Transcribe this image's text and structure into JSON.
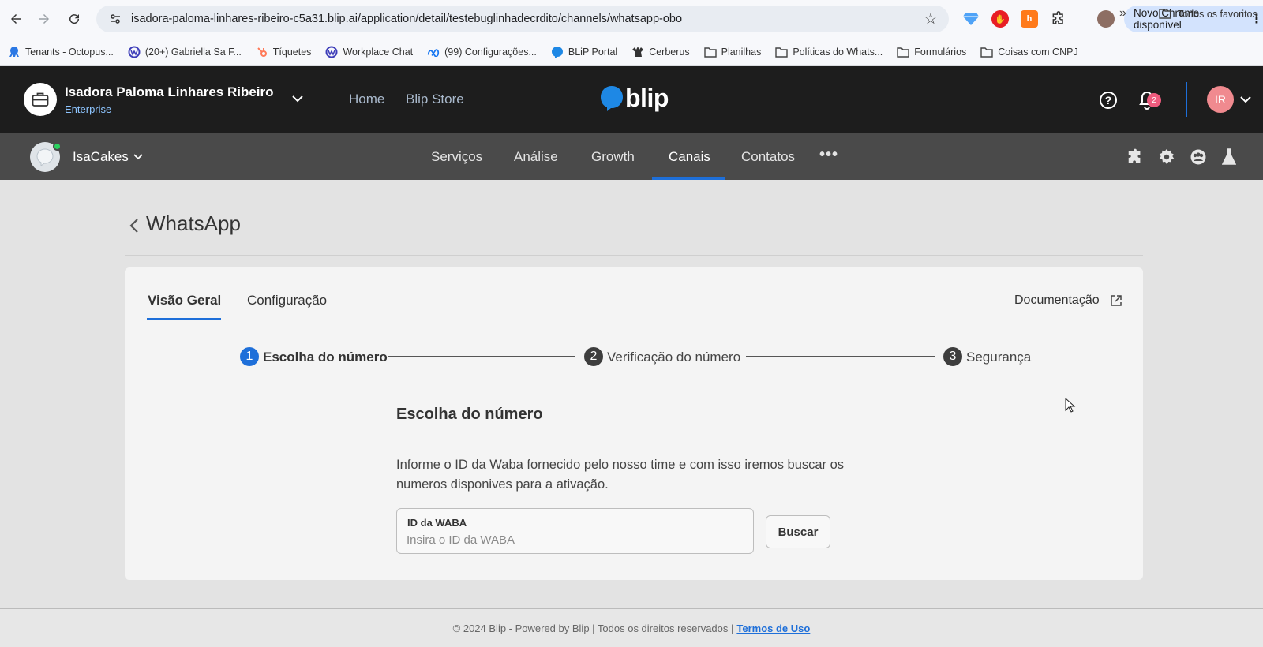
{
  "browser": {
    "url": "isadora-paloma-linhares-ribeiro-c5a31.blip.ai/application/detail/testebuglinhadecrdito/channels/whatsapp-obo",
    "update_label": "Novo Chrome disponível"
  },
  "bookmarks": [
    {
      "label": "Tenants - Octopus...",
      "icon": "octopus-icon",
      "color": "#2b78e4"
    },
    {
      "label": "(20+) Gabriella Sa F...",
      "icon": "workplace-icon",
      "color": "#3b3bb8"
    },
    {
      "label": "Tíquetes",
      "icon": "hubspot-icon",
      "color": "#ff7a59"
    },
    {
      "label": "Workplace Chat",
      "icon": "workplace-icon",
      "color": "#3b3bb8"
    },
    {
      "label": "(99) Configurações...",
      "icon": "meta-icon",
      "color": "#1877f2"
    },
    {
      "label": "BLiP Portal",
      "icon": "blip-icon",
      "color": "#1e88e5"
    },
    {
      "label": "Cerberus",
      "icon": "cerberus-icon",
      "color": "#333333"
    },
    {
      "label": "Planilhas",
      "icon": "folder-icon",
      "color": "#444444"
    },
    {
      "label": "Políticas do Whats...",
      "icon": "folder-icon",
      "color": "#444444"
    },
    {
      "label": "Formulários",
      "icon": "folder-icon",
      "color": "#444444"
    },
    {
      "label": "Coisas com CNPJ",
      "icon": "folder-icon",
      "color": "#444444"
    }
  ],
  "bookmarks_all": "Todos os favoritos",
  "header": {
    "org_name": "Isadora Paloma Linhares Ribeiro",
    "org_plan": "Enterprise",
    "home": "Home",
    "store": "Blip Store",
    "logo_word": "blip",
    "notifications": "2",
    "avatar_initials": "IR"
  },
  "subnav": {
    "bot_name": "IsaCakes",
    "tabs": [
      "Serviços",
      "Análise",
      "Growth",
      "Canais",
      "Contatos"
    ],
    "active_tab": "Canais",
    "more": "•••"
  },
  "page": {
    "title": "WhatsApp",
    "tabs": [
      "Visão Geral",
      "Configuração"
    ],
    "doc_link": "Documentação",
    "steps": [
      {
        "num": "1",
        "label": "Escolha do número",
        "state": "active"
      },
      {
        "num": "2",
        "label": "Verificação do número",
        "state": "pending"
      },
      {
        "num": "3",
        "label": "Segurança",
        "state": "pending"
      }
    ],
    "section_title": "Escolha do número",
    "section_desc": "Informe o ID da Waba fornecido pelo nosso time e com isso iremos buscar os numeros disponives para a ativação.",
    "input_label": "ID da WABA",
    "input_placeholder": "Insira o ID da WABA",
    "input_value": "",
    "search_button": "Buscar"
  },
  "footer": {
    "text": "© 2024 Blip - Powered by Blip | Todos os direitos reservados |",
    "link": "Termos de Uso"
  },
  "colors": {
    "accent": "#1e6fd9",
    "header_bg": "#1d1d1d",
    "subnav_bg": "#4a4a4a",
    "online": "#2ad15e",
    "badge": "#ef5b7e"
  }
}
